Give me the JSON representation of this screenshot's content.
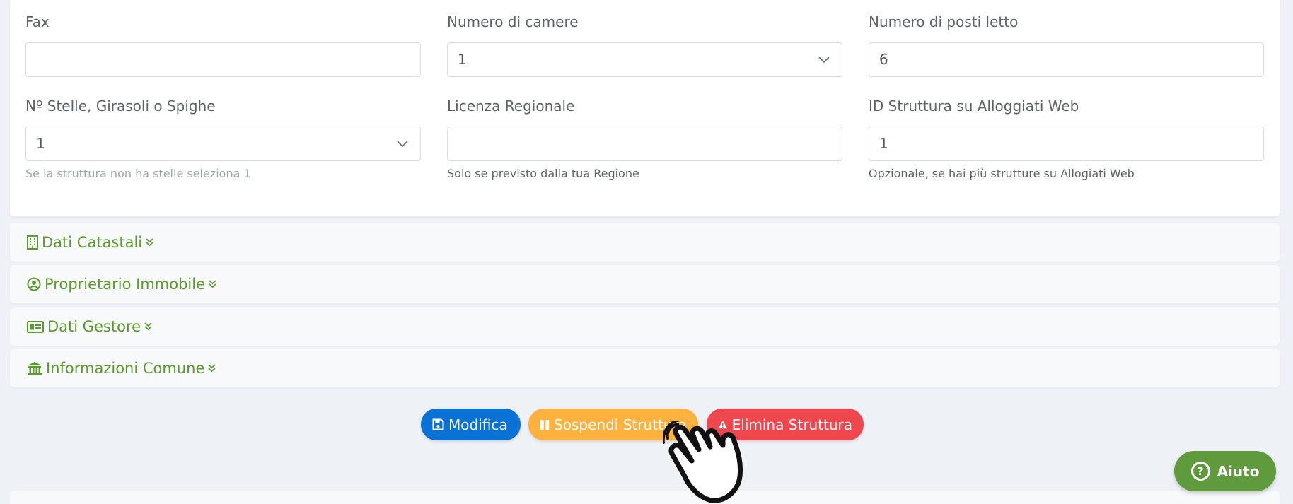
{
  "form": {
    "fax": {
      "label": "Fax",
      "value": ""
    },
    "rooms": {
      "label": "Numero di camere",
      "value": "1"
    },
    "beds": {
      "label": "Numero di posti letto",
      "value": "6"
    },
    "stars": {
      "label": "Nº Stelle, Girasoli o Spighe",
      "value": "1",
      "hint": "Se la struttura non ha stelle seleziona 1"
    },
    "license": {
      "label": "Licenza Regionale",
      "value": "",
      "hint": "Solo se previsto dalla tua Regione"
    },
    "alloggiati_id": {
      "label": "ID Struttura su Alloggiati Web",
      "value": "1",
      "hint": "Opzionale, se hai più strutture su Allogiati Web"
    }
  },
  "sections": [
    {
      "label": "Dati Catastali",
      "icon": "building-icon"
    },
    {
      "label": "Proprietario Immobile",
      "icon": "user-circle-icon"
    },
    {
      "label": "Dati Gestore",
      "icon": "id-card-icon"
    },
    {
      "label": "Informazioni Comune",
      "icon": "landmark-icon"
    }
  ],
  "actions": {
    "edit": {
      "label": "Modifica",
      "icon": "save-icon",
      "color": "#0a72d4"
    },
    "suspend": {
      "label": "Sospendi Struttura",
      "icon": "pause-icon",
      "color": "#fdb23f"
    },
    "delete": {
      "label": "Elimina Struttura",
      "icon": "warning-icon",
      "color": "#f0474e"
    }
  },
  "help": {
    "label": "Aiuto",
    "icon": "question-circle-icon",
    "color": "#5f9b3c"
  },
  "colors": {
    "accent_green": "#5b9a2c",
    "background": "#eef1f5"
  }
}
